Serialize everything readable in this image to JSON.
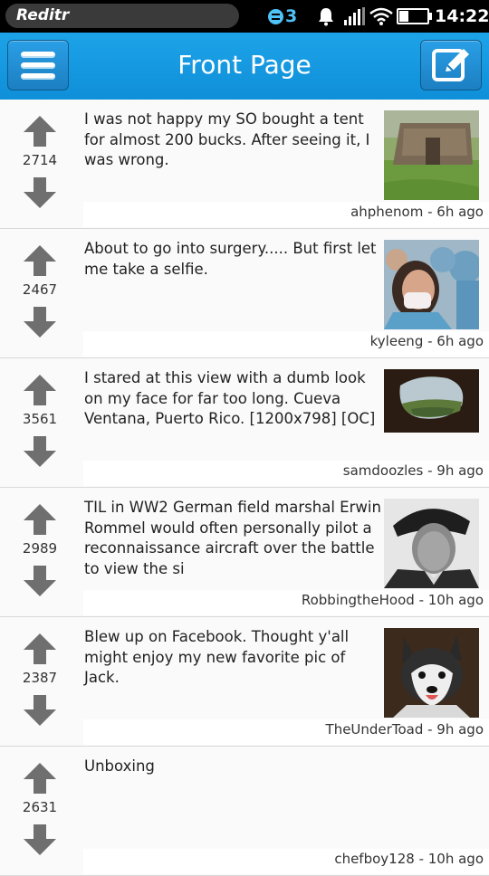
{
  "statusbar": {
    "app_name": "Reditr",
    "notification_count": "3",
    "time": "14:22",
    "icons": [
      "notification-icon",
      "bell-icon",
      "signal-icon",
      "wifi-icon",
      "battery-icon"
    ]
  },
  "header": {
    "title": "Front Page",
    "accent": "#1da3e8"
  },
  "posts": [
    {
      "score": "2714",
      "title": "I was not happy my SO bought a tent for almost 200 bucks. After seeing it, I was wrong.",
      "author": "ahphenom",
      "age": "6h ago",
      "meta": "ahphenom - 6h ago",
      "thumbnail": "tent-photo"
    },
    {
      "score": "2467",
      "title": "About to go into surgery..... But first let me take a selfie.",
      "author": "kyleeng",
      "age": "6h ago",
      "meta": "kyleeng - 6h ago",
      "thumbnail": "surgery-selfie-photo"
    },
    {
      "score": "3561",
      "title": "I stared at this view with a dumb look on my face for far too long. Cueva Ventana, Puerto Rico. [1200x798] [OC]",
      "author": "samdoozles",
      "age": "9h ago",
      "meta": "samdoozles - 9h ago",
      "thumbnail": "cave-view-photo"
    },
    {
      "score": "2989",
      "title": "TIL in WW2 German field marshal Erwin Rommel would often personally pilot a reconnaissance aircraft over the battle to view the si",
      "author": "RobbingtheHood",
      "age": "10h ago",
      "meta": "RobbingtheHood - 10h ago",
      "thumbnail": "portrait-photo"
    },
    {
      "score": "2387",
      "title": "Blew up on Facebook. Thought y'all might enjoy my new favorite pic of Jack.",
      "author": "TheUnderToad",
      "age": "9h ago",
      "meta": "TheUnderToad - 9h ago",
      "thumbnail": "husky-dog-photo"
    },
    {
      "score": "2631",
      "title": "Unboxing",
      "author": "chefboy128",
      "age": "10h ago",
      "meta": "chefboy128 - 10h ago",
      "thumbnail": ""
    }
  ]
}
